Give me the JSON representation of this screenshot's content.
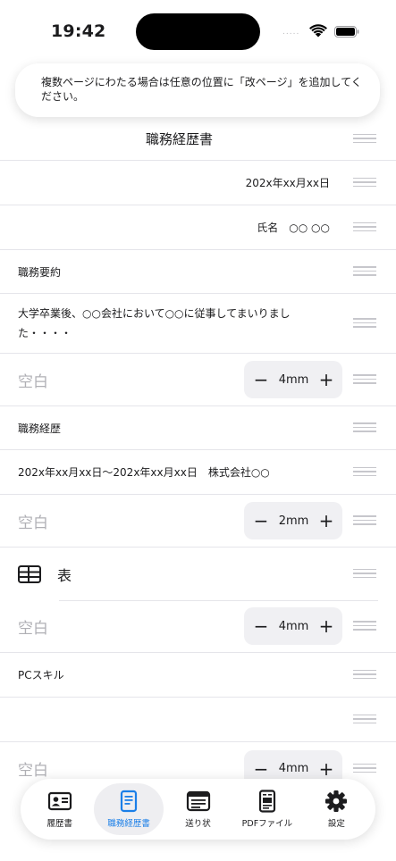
{
  "status_bar": {
    "time": "19:42",
    "signal": "....."
  },
  "banner": {
    "text": "複数ページにわたる場合は任意の位置に「改ページ」を追加してください。"
  },
  "rows": [
    {
      "text": "職務経歴書"
    },
    {
      "text": "202x年xx月xx日"
    },
    {
      "text": "氏名　○○ ○○"
    },
    {
      "text": "職務要約"
    },
    {
      "text": "大学卒業後、○○会社において○○に従事してまいりました・・・・"
    },
    {
      "label": "空白",
      "value": "4mm"
    },
    {
      "text": "職務経歴"
    },
    {
      "text": "202x年xx月xx日〜202x年xx月xx日　株式会社○○"
    },
    {
      "label": "空白",
      "value": "2mm"
    },
    {
      "text": "表"
    },
    {
      "label": "空白",
      "value": "4mm"
    },
    {
      "text": "PCスキル"
    },
    {
      "text": ""
    },
    {
      "label": "空白",
      "value": "4mm"
    }
  ],
  "stepper": {
    "minus": "−",
    "plus": "+"
  },
  "tabs": [
    {
      "label": "履歴書",
      "icon": "id-card-icon"
    },
    {
      "label": "職務経歴書",
      "icon": "document-icon"
    },
    {
      "label": "送り状",
      "icon": "letter-icon"
    },
    {
      "label": "PDFファイル",
      "icon": "pdf-file-icon"
    },
    {
      "label": "設定",
      "icon": "gear-icon"
    }
  ],
  "colors": {
    "accent": "#1b7fe8",
    "separator": "#e5e5ea",
    "placeholder": "#b0b0b5"
  }
}
